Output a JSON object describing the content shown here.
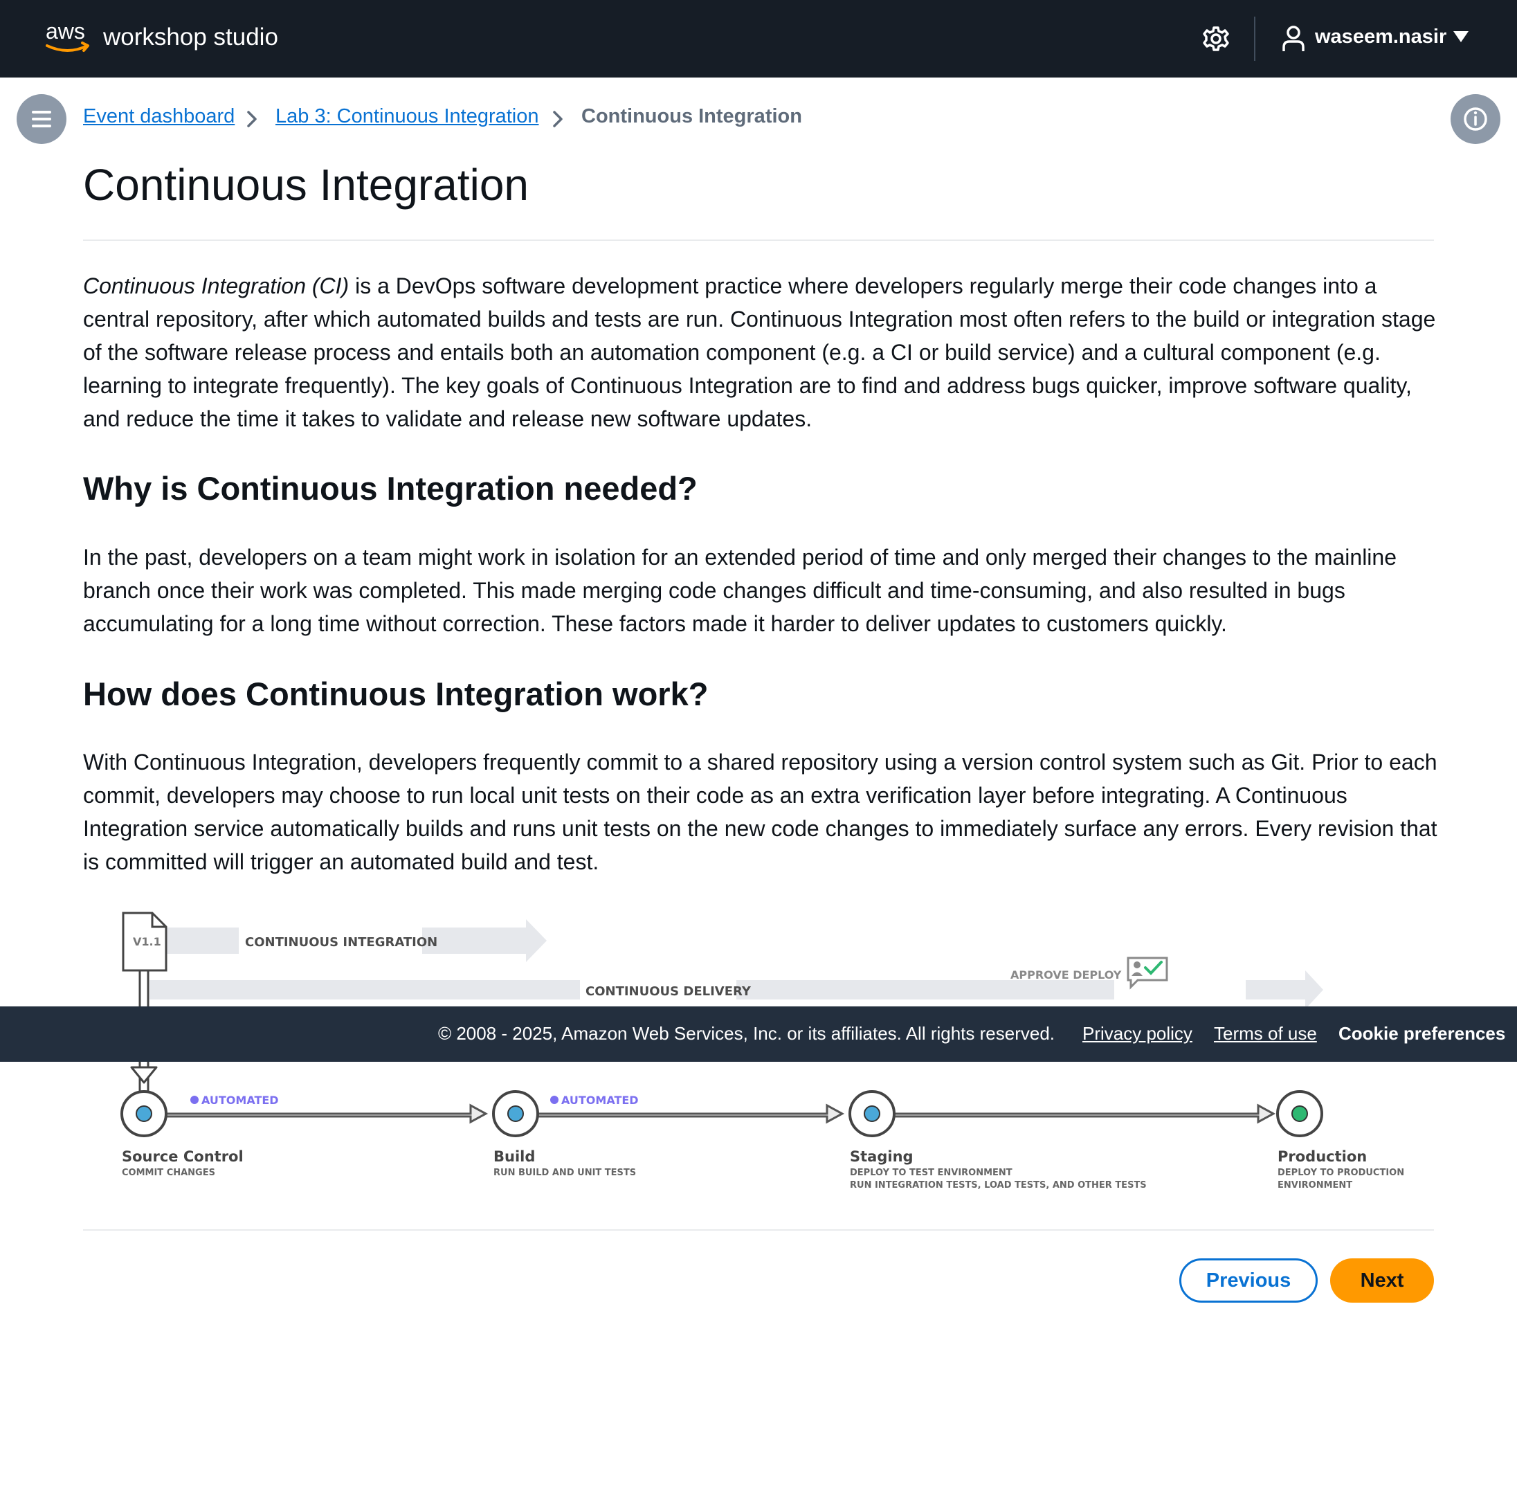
{
  "header": {
    "brand": "aws",
    "product": "workshop studio",
    "settings_icon": "gear-icon",
    "user_icon": "user-icon",
    "username": "waseem.nasir"
  },
  "breadcrumb": {
    "items": [
      "Event dashboard",
      "Lab 3: Continuous Integration"
    ],
    "current": "Continuous Integration"
  },
  "page": {
    "title": "Continuous Integration",
    "intro_em": "Continuous Integration (CI)",
    "intro_rest": " is a DevOps software development practice where developers regularly merge their code changes into a central repository, after which automated builds and tests are run. Continuous Integration most often refers to the build or integration stage of the software release process and entails both an automation component (e.g. a CI or build service) and a cultural component (e.g. learning to integrate frequently). The key goals of Continuous Integration are to find and address bugs quicker, improve software quality, and reduce the time it takes to validate and release new software updates.",
    "h2_why": "Why is Continuous Integration needed?",
    "why_text": "In the past, developers on a team might work in isolation for an extended period of time and only merged their changes to the mainline branch once their work was completed. This made merging code changes difficult and time-consuming, and also resulted in bugs accumulating for a long time without correction. These factors made it harder to deliver updates to customers quickly.",
    "h2_how": "How does Continuous Integration work?",
    "how_text": "With Continuous Integration, developers frequently commit to a shared repository using a version control system such as Git. Prior to each commit, developers may choose to run local unit tests on their code as an extra verification layer before integrating. A Continuous Integration service automatically builds and runs unit tests on the new code changes to immediately surface any errors. Every revision that is committed will trigger an automated build and test."
  },
  "diagram": {
    "version": "V1.1",
    "ci_label": "CONTINUOUS INTEGRATION",
    "cd_label": "CONTINUOUS DELIVERY",
    "approve_label": "APPROVE DEPLOY",
    "automated": "AUTOMATED",
    "stages": [
      {
        "name": "Source Control",
        "desc1": "COMMIT CHANGES",
        "desc2": ""
      },
      {
        "name": "Build",
        "desc1": "RUN BUILD AND UNIT TESTS",
        "desc2": ""
      },
      {
        "name": "Staging",
        "desc1": "DEPLOY TO TEST ENVIRONMENT",
        "desc2": "RUN INTEGRATION TESTS, LOAD TESTS, AND OTHER TESTS"
      },
      {
        "name": "Production",
        "desc1": "DEPLOY TO PRODUCTION",
        "desc2": "ENVIRONMENT"
      }
    ],
    "colors": {
      "node_blue": "#4aa8d8",
      "node_green": "#2eb872",
      "automated": "#7b6ff0"
    }
  },
  "footer": {
    "copyright": "© 2008 - 2025, Amazon Web Services, Inc. or its affiliates. All rights reserved.",
    "privacy": "Privacy policy",
    "terms": "Terms of use",
    "cookies": "Cookie preferences"
  },
  "nav": {
    "previous": "Previous",
    "next": "Next"
  },
  "colors": {
    "topbar": "#161d26",
    "link": "#0972d3",
    "footer": "#232f3e",
    "primary_button": "#ff9900"
  }
}
